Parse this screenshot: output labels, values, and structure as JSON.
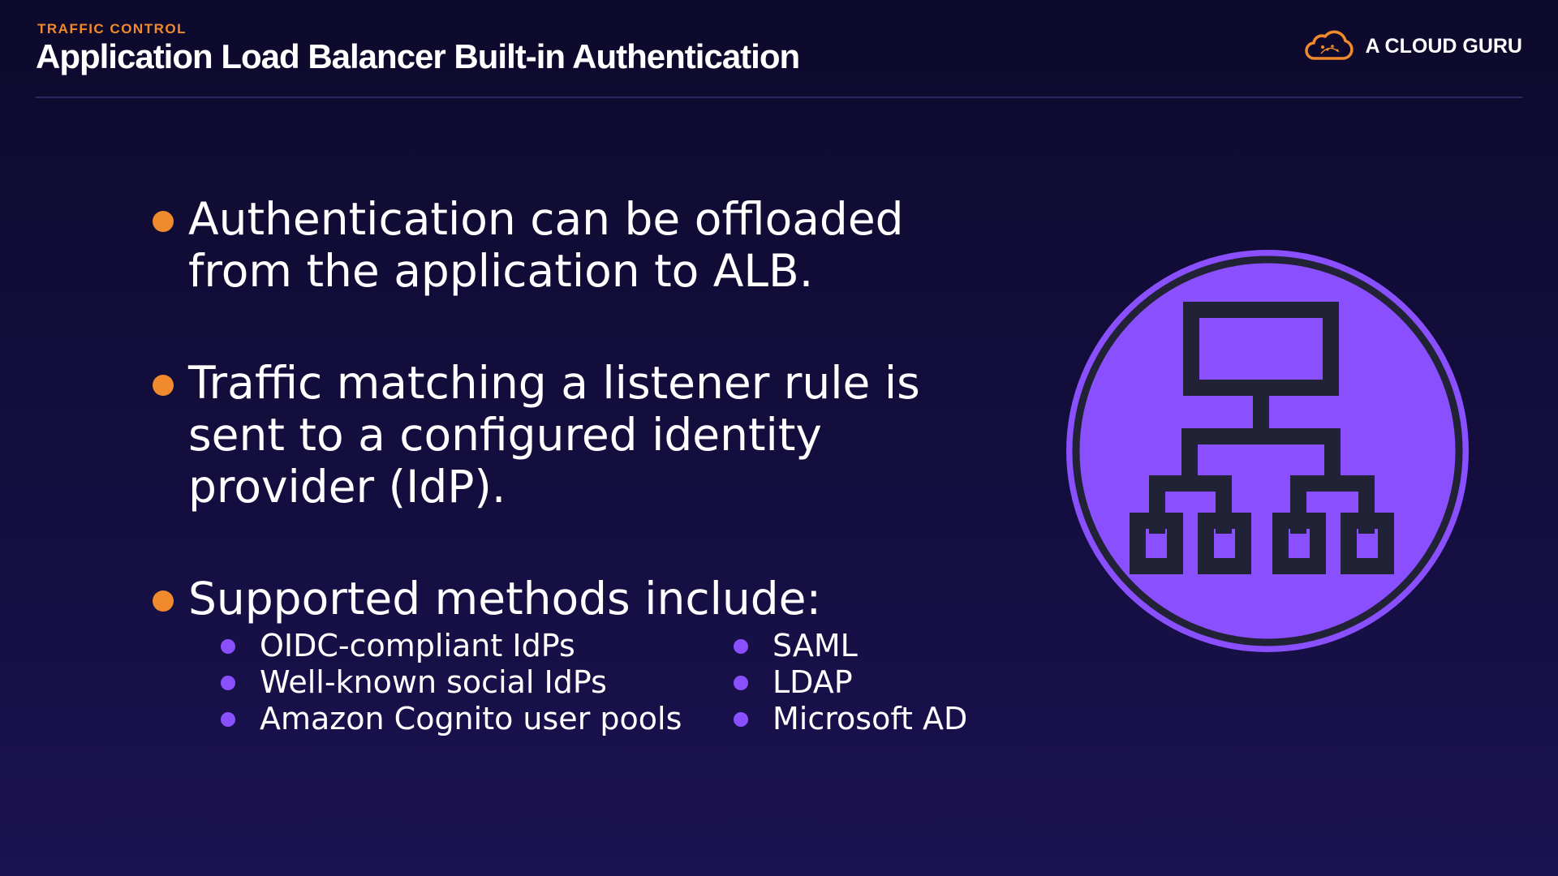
{
  "header": {
    "eyebrow": "TRAFFIC CONTROL",
    "title": "Application Load Balancer Built-in Authentication",
    "brand": "A CLOUD GURU"
  },
  "bullets": [
    {
      "lines": [
        "Authentication can be offloaded",
        "from the application to ALB."
      ]
    },
    {
      "lines": [
        "Traffic matching a listener rule is",
        "sent to a configured identity",
        "provider (IdP)."
      ]
    },
    {
      "lines": [
        "Supported methods include:"
      ]
    }
  ],
  "methods": {
    "left": [
      "OIDC-compliant IdPs",
      "Well-known social IdPs",
      "Amazon Cognito user pools"
    ],
    "right": [
      "SAML",
      "LDAP",
      "Microsoft AD"
    ]
  },
  "icons": {
    "brand_logo": "cloud-icon",
    "graphic": "hierarchy-icon"
  },
  "colors": {
    "accent_orange": "#f08a2c",
    "accent_purple": "#8a4fff",
    "background": "#120d3a"
  }
}
